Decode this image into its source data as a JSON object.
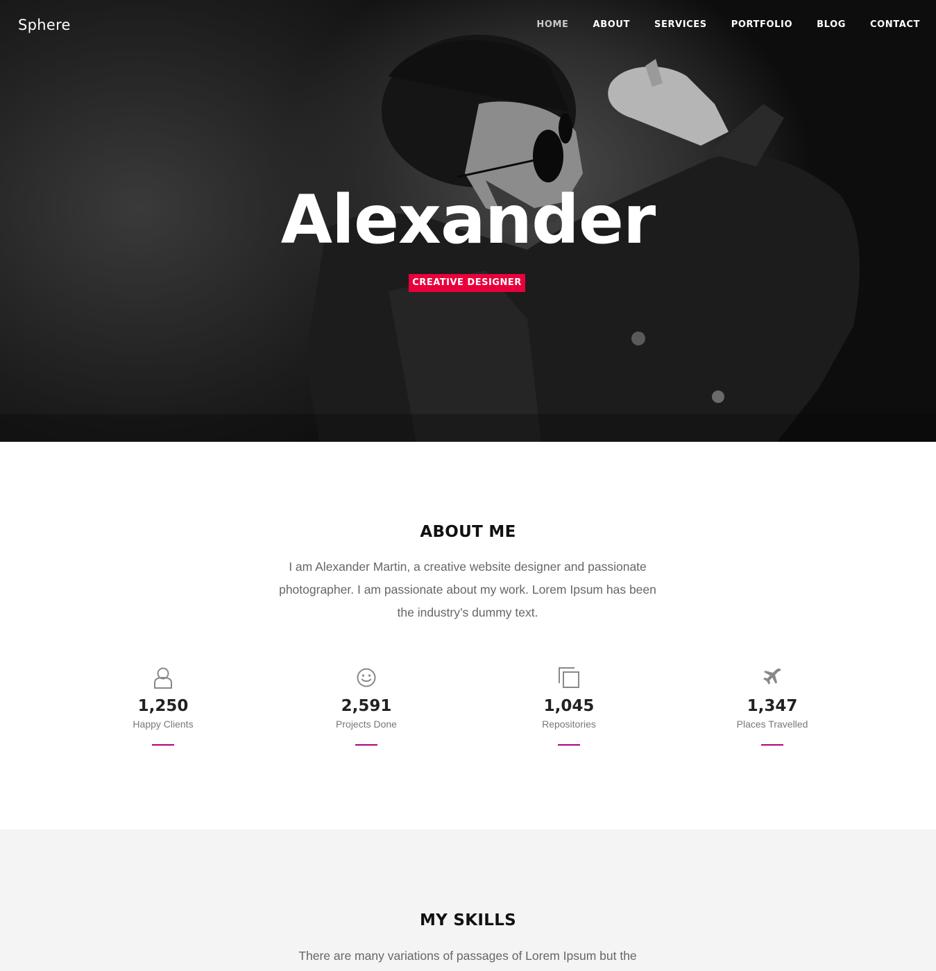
{
  "nav": {
    "brand": "Sphere",
    "items": [
      "HOME",
      "ABOUT",
      "SERVICES",
      "PORTFOLIO",
      "BLOG",
      "CONTACT"
    ],
    "active": "HOME"
  },
  "hero": {
    "title": "Alexander",
    "badge": "CREATIVE DESIGNER",
    "badge_color": "#e8003c"
  },
  "about": {
    "title": "ABOUT ME",
    "text": "I am Alexander Martin, a creative website designer and passionate photographer. I am passionate about my work. Lorem Ipsum has been the industry’s dummy text.",
    "stats": [
      {
        "icon": "user-icon",
        "value": "1,250",
        "label": "Happy Clients"
      },
      {
        "icon": "smiley-icon",
        "value": "2,591",
        "label": "Projects Done"
      },
      {
        "icon": "copy-icon",
        "value": "1,045",
        "label": "Repositories"
      },
      {
        "icon": "airplane-icon",
        "value": "1,347",
        "label": "Places Travelled"
      }
    ],
    "accent_color": "#b0007a"
  },
  "skills": {
    "title": "MY SKILLS",
    "text": "There are many variations of passages of Lorem Ipsum but the"
  }
}
